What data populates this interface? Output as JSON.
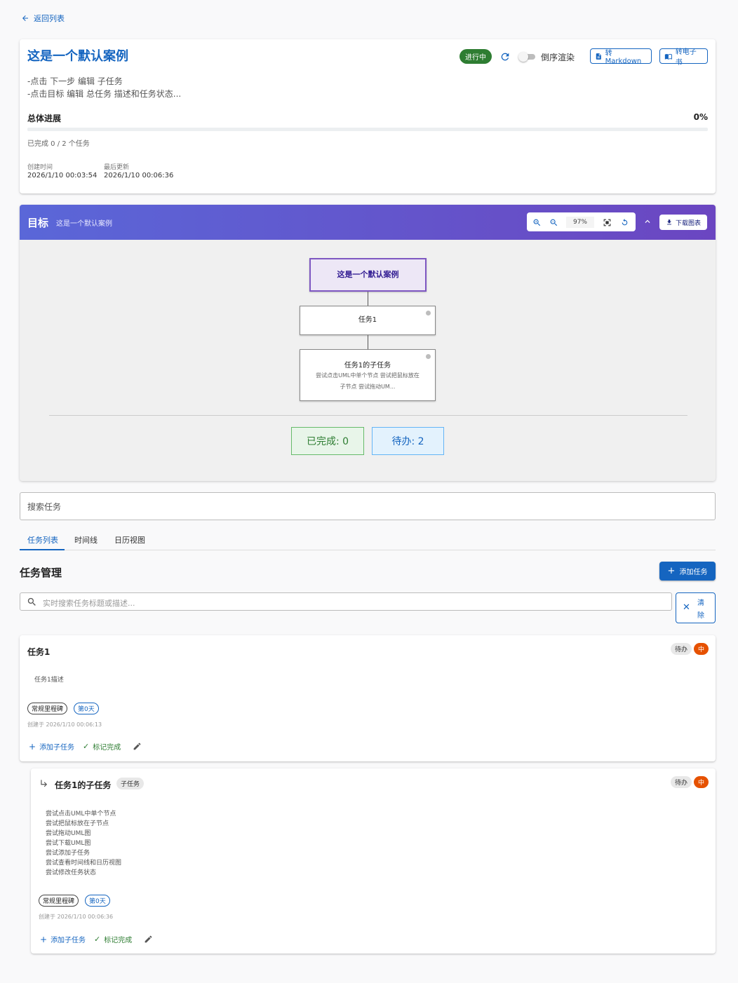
{
  "nav": {
    "back_label": "返回列表"
  },
  "project": {
    "title": "这是一个默认案例",
    "desc_lines": [
      "-点击 下一步 编辑 子任务",
      "-点击目标 编辑 总任务 描述和任务状态..."
    ],
    "status": "进行中",
    "reverse_render_label": "倒序渲染",
    "to_markdown_label": "转Markdown",
    "to_ebook_label": "转电子书",
    "progress_label": "总体进展",
    "progress_pct": "0%",
    "progress_fraction": 0,
    "completed_text": "已完成 0 / 2 个任务",
    "created_label": "创建时间",
    "created_value": "2026/1/10 00:03:54",
    "updated_label": "最后更新",
    "updated_value": "2026/1/10 00:06:36"
  },
  "goal": {
    "title": "目标",
    "subtitle": "这是一个默认案例",
    "zoom": "97%",
    "download_label": "下载图表",
    "root_node": "这是一个默认案例",
    "node1": "任务1",
    "node2_title": "任务1的子任务",
    "node2_desc": [
      "尝试点击UML中单个节点 尝试把鼠标放在",
      "子节点 尝试拖动UM..."
    ],
    "done_stat": "已完成: 0",
    "todo_stat": "待办: 2",
    "colors": {
      "header_start": "#5a67d8",
      "header_end": "#6b46c1",
      "done_bg": "#e8f5e9",
      "todo_bg": "#e3f2fd"
    }
  },
  "search": {
    "placeholder": "搜索任务"
  },
  "tabs": [
    "任务列表",
    "时间线",
    "日历视图"
  ],
  "tasks_section": {
    "title": "任务管理",
    "add_label": "添加任务",
    "live_search_placeholder": "实时搜索任务标题或描述...",
    "clear_label": "清除"
  },
  "tasks": [
    {
      "title": "任务1",
      "status": "待办",
      "priority": "中",
      "desc": "任务1描述",
      "tag_milestone": "常规里程碑",
      "tag_day": "第0天",
      "created": "创建于 2026/1/10 00:06:13",
      "add_sub_label": "添加子任务",
      "mark_done_label": "标记完成"
    },
    {
      "title": "任务1的子任务",
      "sub_chip": "子任务",
      "status": "待办",
      "priority": "中",
      "desc_lines": [
        "尝试点击UML中单个节点",
        "尝试把鼠标放在子节点",
        "尝试拖动UML图",
        "尝试下载UML图",
        "尝试添加子任务",
        "尝试查看时间线和日历视图",
        "尝试修改任务状态"
      ],
      "tag_milestone": "常规里程碑",
      "tag_day": "第0天",
      "created": "创建于 2026/1/10 00:06:36",
      "add_sub_label": "添加子任务",
      "mark_done_label": "标记完成"
    }
  ]
}
